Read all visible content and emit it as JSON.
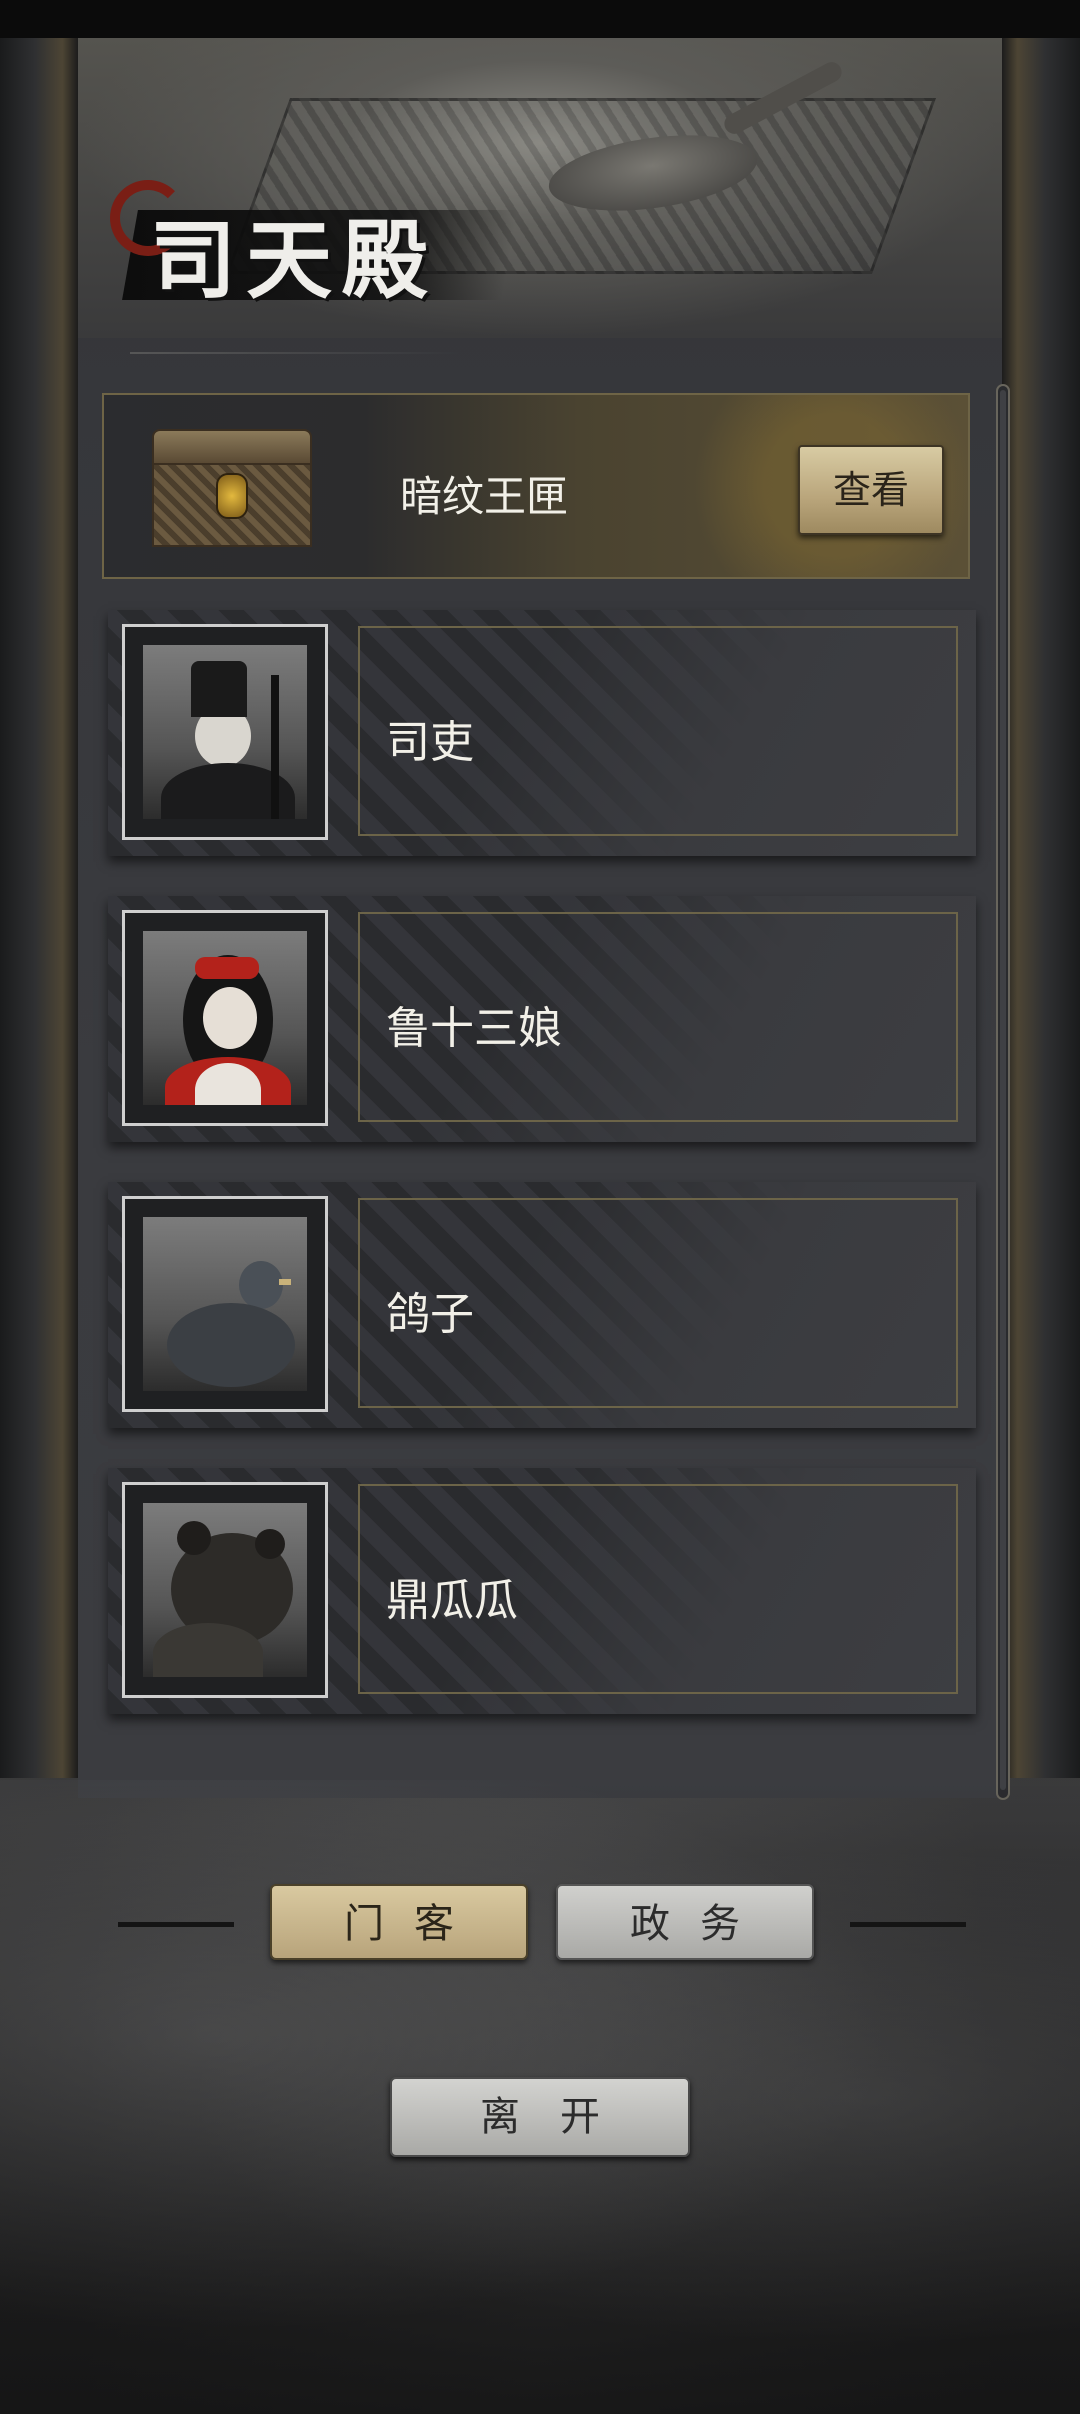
{
  "header": {
    "title": "司天殿"
  },
  "chest": {
    "name": "暗纹王匣",
    "view_label": "查看"
  },
  "members": [
    {
      "name": "司吏",
      "portrait": "official-portrait"
    },
    {
      "name": "鲁十三娘",
      "portrait": "woman-red-bow-portrait"
    },
    {
      "name": "鸽子",
      "portrait": "pigeon-portrait"
    },
    {
      "name": "鼎瓜瓜",
      "portrait": "bear-portrait"
    }
  ],
  "tabs": [
    {
      "label": "门客",
      "active": true
    },
    {
      "label": "政务",
      "active": false
    }
  ],
  "footer": {
    "leave_label": "离开"
  },
  "colors": {
    "gold_accent": "#b8a47b",
    "panel": "#36373b",
    "text_light": "#f2f0e8"
  }
}
